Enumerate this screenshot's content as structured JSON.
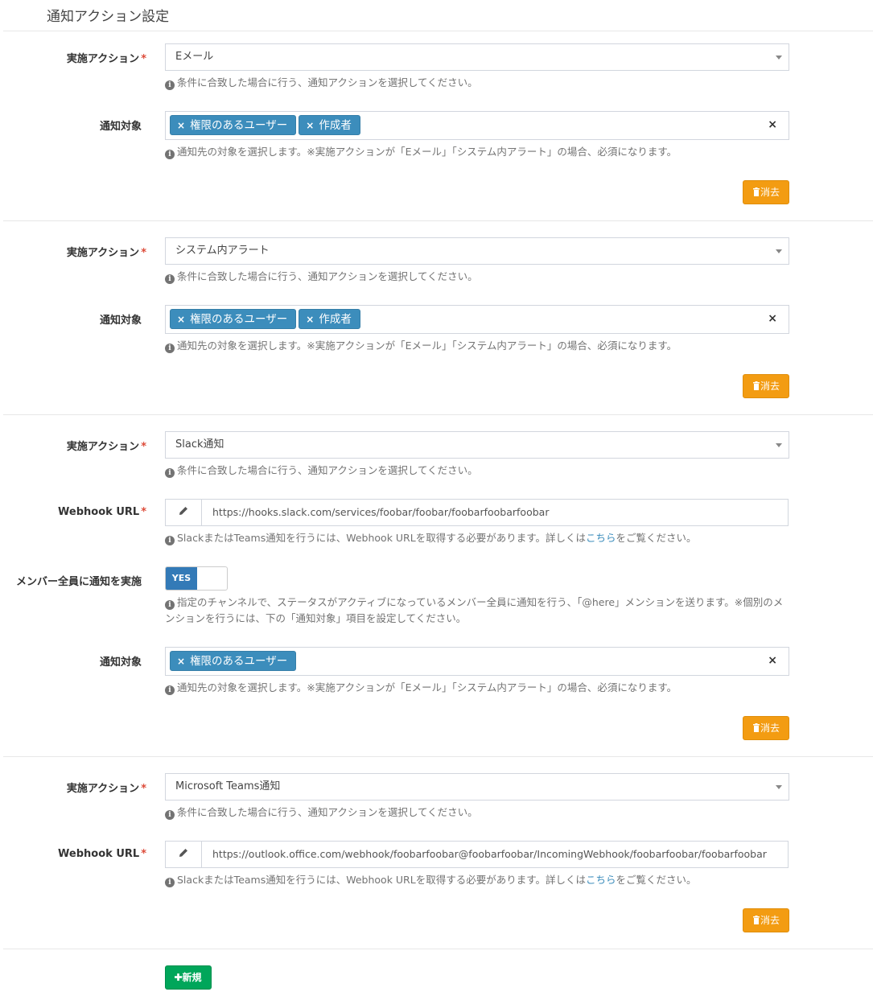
{
  "page_title": "通知アクション設定",
  "labels": {
    "action": "実施アクション",
    "target": "通知対象",
    "webhook": "Webhook URL",
    "mention_all": "メンバー全員に通知を実施",
    "required_mark": "*"
  },
  "help": {
    "action": "条件に合致した場合に行う、通知アクションを選択してください。",
    "target": "通知先の対象を選択します。※実施アクションが「Eメール」「システム内アラート」の場合、必須になります。",
    "webhook_prefix": "SlackまたはTeams通知を行うには、Webhook URLを取得する必要があります。詳しくは",
    "webhook_link": "こちら",
    "webhook_suffix": "をご覧ください。",
    "mention_all": "指定のチャンネルで、ステータスがアクティブになっているメンバー全員に通知を行う、「@here」メンションを送ります。※個別のメンションを行うには、下の「通知対象」項目を設定してください。"
  },
  "info_icon_glyph": "i",
  "tag_remove_glyph": "×",
  "clear_glyph": "×",
  "delete_button": {
    "icon": "trash-icon",
    "label": "消去"
  },
  "new_button": {
    "icon": "plus-icon",
    "label": "新規"
  },
  "toggle": {
    "on_label": "YES",
    "value": true
  },
  "actions": [
    {
      "action": "Eメール",
      "targets": [
        "権限のあるユーザー",
        "作成者"
      ]
    },
    {
      "action": "システム内アラート",
      "targets": [
        "権限のあるユーザー",
        "作成者"
      ]
    },
    {
      "action": "Slack通知",
      "webhook_url": "https://hooks.slack.com/services/foobar/foobar/foobarfoobarfoobar",
      "targets": [
        "権限のあるユーザー"
      ]
    },
    {
      "action": "Microsoft Teams通知",
      "webhook_url": "https://outlook.office.com/webhook/foobarfoobar@foobarfoobar/IncomingWebhook/foobarfoobar/foobarfoobar"
    }
  ],
  "colors": {
    "tag_bg": "#3c8dbc",
    "delete_btn": "#f39c12",
    "new_btn": "#00a65a",
    "toggle_on": "#337ab7",
    "required": "#dd4b39",
    "link": "#3c8dbc"
  }
}
